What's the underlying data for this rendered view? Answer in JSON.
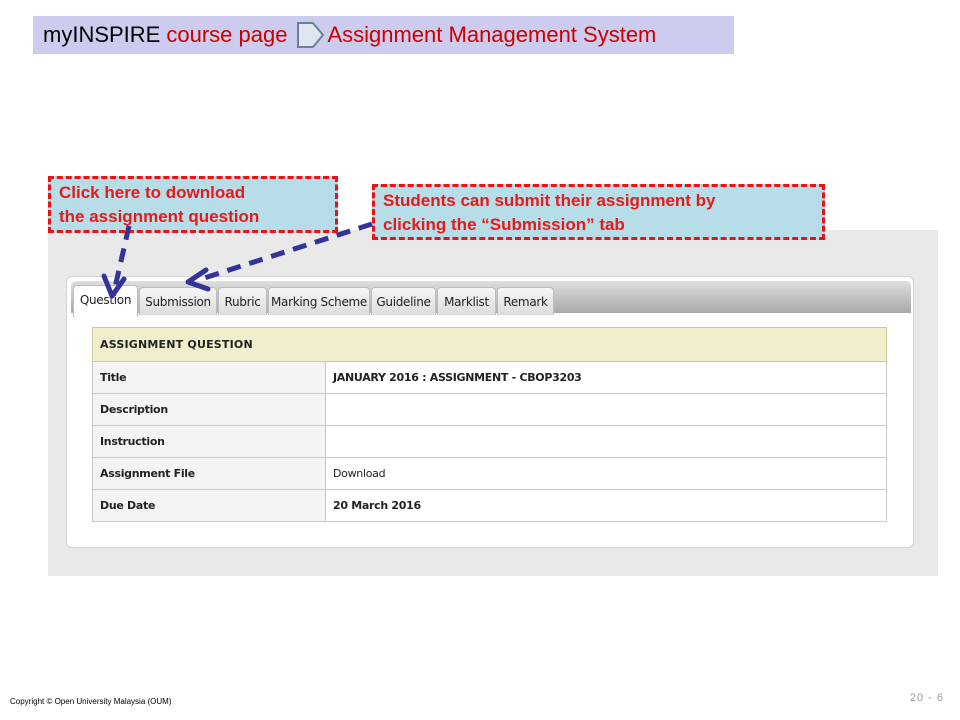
{
  "banner": {
    "part1": "myINSPIRE",
    "part2": "course page",
    "part3": "Assignment Management System",
    "bg_color": "#ccccee",
    "accent_color": "#cc0000"
  },
  "tabs": [
    {
      "label": "Question",
      "active": true
    },
    {
      "label": "Submission",
      "active": false
    },
    {
      "label": "Rubric",
      "active": false
    },
    {
      "label": "Marking Scheme",
      "active": false
    },
    {
      "label": "Guideline",
      "active": false
    },
    {
      "label": "Marklist",
      "active": false
    },
    {
      "label": "Remark",
      "active": false
    }
  ],
  "table": {
    "header": "ASSIGNMENT QUESTION",
    "rows": [
      {
        "label": "Title",
        "value": "JANUARY 2016 : ASSIGNMENT - CBOP3203"
      },
      {
        "label": "Description",
        "value": ""
      },
      {
        "label": "Instruction",
        "value": ""
      },
      {
        "label": "Assignment File",
        "value": "Download"
      },
      {
        "label": "Due Date",
        "value": "20 March 2016"
      }
    ]
  },
  "callouts": {
    "download": {
      "line1": "Click here to download",
      "line2": "the assignment question"
    },
    "submission": {
      "line1": "Students can submit their assignment by",
      "line2": "clicking the “Submission” tab"
    },
    "text_color": "#e31b1b",
    "border_color": "#ee1111",
    "fill_color": "#b7dde8",
    "arrow_color": "#33339a"
  },
  "footer": {
    "copyright": "Copyright © Open University Malaysia (OUM)",
    "page": "20 - 6"
  }
}
